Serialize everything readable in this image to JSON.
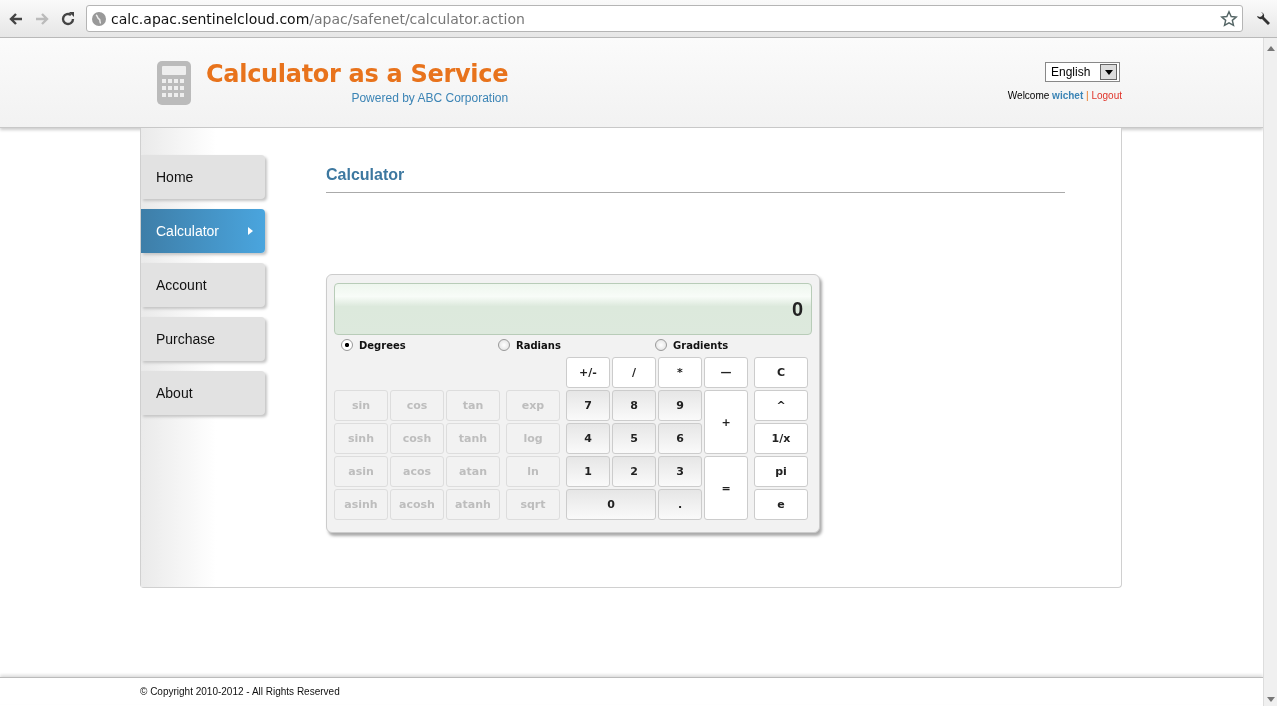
{
  "browser": {
    "url_host": "calc.apac.sentinelcloud.com",
    "url_path": "/apac/safenet/calculator.action"
  },
  "header": {
    "title": "Calculator as a Service",
    "subtitle": "Powered by ABC Corporation",
    "language": "English",
    "welcome": "Welcome",
    "user": "wichet",
    "separator": "|",
    "logout": "Logout"
  },
  "sidebar": {
    "items": [
      {
        "label": "Home",
        "selected": false
      },
      {
        "label": "Calculator",
        "selected": true
      },
      {
        "label": "Account",
        "selected": false
      },
      {
        "label": "Purchase",
        "selected": false
      },
      {
        "label": "About",
        "selected": false
      }
    ]
  },
  "page_title": "Calculator",
  "calculator": {
    "display": "0",
    "modes": [
      {
        "label": "Degrees",
        "selected": true
      },
      {
        "label": "Radians",
        "selected": false
      },
      {
        "label": "Gradients",
        "selected": false
      }
    ],
    "buttons": [
      {
        "label": "+/-",
        "kind": "operator",
        "disabled": false
      },
      {
        "label": "/",
        "kind": "operator",
        "disabled": false
      },
      {
        "label": "*",
        "kind": "operator",
        "disabled": false
      },
      {
        "label": "—",
        "kind": "operator",
        "disabled": false
      },
      {
        "label": "C",
        "kind": "operator",
        "disabled": false
      },
      {
        "label": "sin",
        "kind": "function",
        "disabled": true
      },
      {
        "label": "cos",
        "kind": "function",
        "disabled": true
      },
      {
        "label": "tan",
        "kind": "function",
        "disabled": true
      },
      {
        "label": "exp",
        "kind": "function",
        "disabled": true
      },
      {
        "label": "7",
        "kind": "digit",
        "disabled": false
      },
      {
        "label": "8",
        "kind": "digit",
        "disabled": false
      },
      {
        "label": "9",
        "kind": "digit",
        "disabled": false
      },
      {
        "label": "+",
        "kind": "operator",
        "disabled": false
      },
      {
        "label": "^",
        "kind": "operator",
        "disabled": false
      },
      {
        "label": "sinh",
        "kind": "function",
        "disabled": true
      },
      {
        "label": "cosh",
        "kind": "function",
        "disabled": true
      },
      {
        "label": "tanh",
        "kind": "function",
        "disabled": true
      },
      {
        "label": "log",
        "kind": "function",
        "disabled": true
      },
      {
        "label": "4",
        "kind": "digit",
        "disabled": false
      },
      {
        "label": "5",
        "kind": "digit",
        "disabled": false
      },
      {
        "label": "6",
        "kind": "digit",
        "disabled": false
      },
      {
        "label": "1/x",
        "kind": "operator",
        "disabled": false
      },
      {
        "label": "asin",
        "kind": "function",
        "disabled": true
      },
      {
        "label": "acos",
        "kind": "function",
        "disabled": true
      },
      {
        "label": "atan",
        "kind": "function",
        "disabled": true
      },
      {
        "label": "ln",
        "kind": "function",
        "disabled": true
      },
      {
        "label": "1",
        "kind": "digit",
        "disabled": false
      },
      {
        "label": "2",
        "kind": "digit",
        "disabled": false
      },
      {
        "label": "3",
        "kind": "digit",
        "disabled": false
      },
      {
        "label": "=",
        "kind": "operator",
        "disabled": false
      },
      {
        "label": "pi",
        "kind": "operator",
        "disabled": false
      },
      {
        "label": "asinh",
        "kind": "function",
        "disabled": true
      },
      {
        "label": "acosh",
        "kind": "function",
        "disabled": true
      },
      {
        "label": "atanh",
        "kind": "function",
        "disabled": true
      },
      {
        "label": "sqrt",
        "kind": "function",
        "disabled": true
      },
      {
        "label": "0",
        "kind": "digit",
        "disabled": false
      },
      {
        "label": ".",
        "kind": "digit",
        "disabled": false
      },
      {
        "label": "e",
        "kind": "operator",
        "disabled": false
      }
    ]
  },
  "footer": "© Copyright 2010-2012 - All Rights Reserved"
}
